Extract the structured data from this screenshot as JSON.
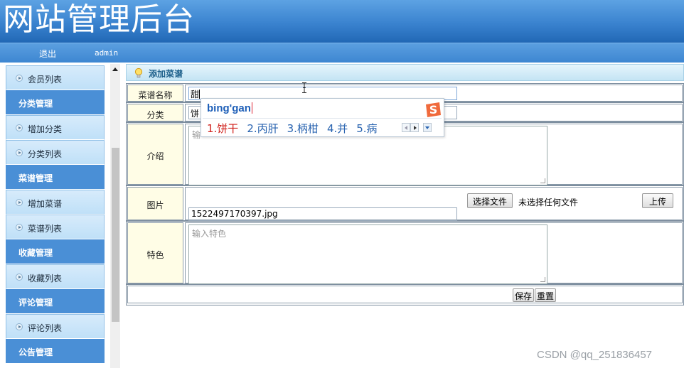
{
  "header": {
    "title": "网站管理后台"
  },
  "topbar": {
    "logout": "退出",
    "user": "admin"
  },
  "sidebar": {
    "entries": [
      {
        "type": "item",
        "label": "会员列表"
      },
      {
        "type": "group",
        "label": "分类管理"
      },
      {
        "type": "item",
        "label": "增加分类"
      },
      {
        "type": "item",
        "label": "分类列表"
      },
      {
        "type": "group",
        "label": "菜谱管理"
      },
      {
        "type": "item",
        "label": "增加菜谱"
      },
      {
        "type": "item",
        "label": "菜谱列表"
      },
      {
        "type": "group",
        "label": "收藏管理"
      },
      {
        "type": "item",
        "label": "收藏列表"
      },
      {
        "type": "group",
        "label": "评论管理"
      },
      {
        "type": "item",
        "label": "评论列表"
      },
      {
        "type": "group",
        "label": "公告管理"
      }
    ]
  },
  "panel": {
    "title": "添加菜谱"
  },
  "form": {
    "name_label": "菜谱名称",
    "name_value": "甜",
    "category_label": "分类",
    "category_value": "饼",
    "intro_label": "介绍",
    "intro_placeholder": "输",
    "image_label": "图片",
    "choose_file": "选择文件",
    "file_status": "未选择任何文件",
    "upload": "上传",
    "image_path": "1522497170397.jpg",
    "feature_label": "特色",
    "feature_placeholder": "输入特色",
    "save": "保存",
    "reset": "重置"
  },
  "ime": {
    "pinyin": "bing'gan",
    "candidates": [
      "1.饼干",
      "2.丙肝",
      "3.柄柑",
      "4.并",
      "5.病"
    ],
    "colors": {
      "first": "#d0201b",
      "rest": "#2a64b0",
      "logo": "#f06a3c"
    }
  },
  "watermark": "CSDN @qq_251836457"
}
